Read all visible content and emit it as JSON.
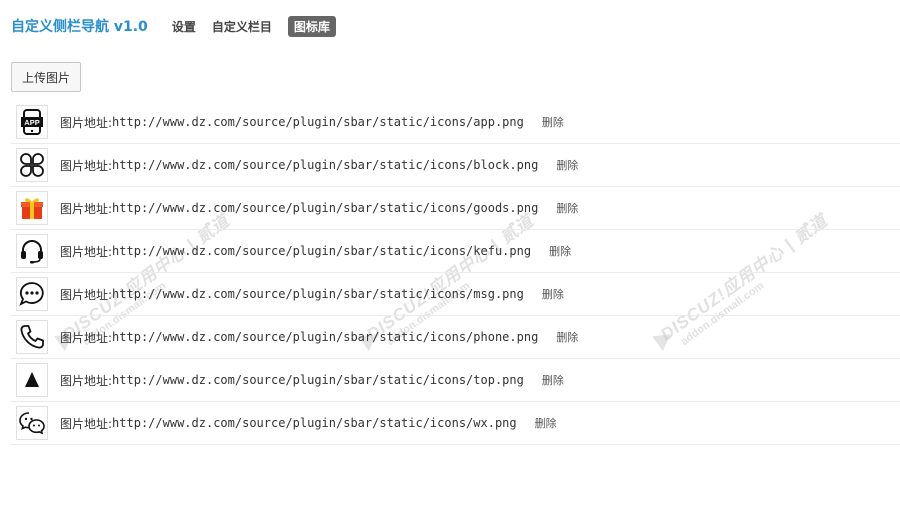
{
  "header": {
    "title": "自定义侧栏导航 v1.0",
    "tabs": [
      {
        "label": "设置",
        "active": false
      },
      {
        "label": "自定义栏目",
        "active": false
      },
      {
        "label": "图标库",
        "active": true
      }
    ]
  },
  "upload_label": "上传图片",
  "list": {
    "label": "图片地址:",
    "delete_label": "删除",
    "items": [
      {
        "icon": "app-icon",
        "url": "http://www.dz.com/source/plugin/sbar/static/icons/app.png"
      },
      {
        "icon": "block-icon",
        "url": "http://www.dz.com/source/plugin/sbar/static/icons/block.png"
      },
      {
        "icon": "goods-icon",
        "url": "http://www.dz.com/source/plugin/sbar/static/icons/goods.png"
      },
      {
        "icon": "kefu-icon",
        "url": "http://www.dz.com/source/plugin/sbar/static/icons/kefu.png"
      },
      {
        "icon": "msg-icon",
        "url": "http://www.dz.com/source/plugin/sbar/static/icons/msg.png"
      },
      {
        "icon": "phone-icon",
        "url": "http://www.dz.com/source/plugin/sbar/static/icons/phone.png"
      },
      {
        "icon": "top-icon",
        "url": "http://www.dz.com/source/plugin/sbar/static/icons/top.png"
      },
      {
        "icon": "wx-icon",
        "url": "http://www.dz.com/source/plugin/sbar/static/icons/wx.png"
      }
    ]
  },
  "watermark": {
    "text": "DISCUZ!应用中心 | 贰道",
    "subtext": "addon.dismall.com"
  },
  "colors": {
    "title": "#2b8fce",
    "active_tab_bg": "#666666",
    "row_border": "#ebebeb"
  }
}
